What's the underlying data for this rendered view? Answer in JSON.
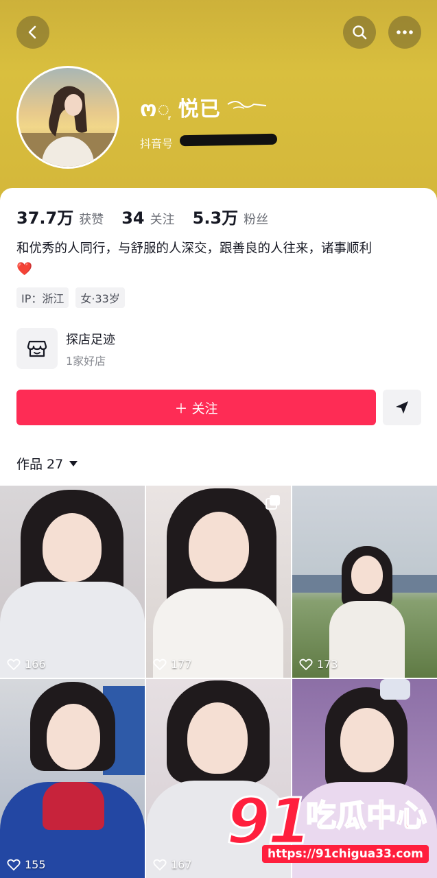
{
  "header": {
    "name": "ო◌᷊ 悦已",
    "douyin_id_label": "抖音号",
    "background_color": "#d9bf3e"
  },
  "icons": {
    "back": "back-icon",
    "search": "search-icon",
    "more": "more-icon",
    "shop": "shop-icon",
    "send": "send-icon",
    "dropdown": "caret-down-icon",
    "like": "heart-icon"
  },
  "stats": {
    "likes_num": "37.7万",
    "likes_label": "获赞",
    "following_num": "34",
    "following_label": "关注",
    "followers_num": "5.3万",
    "followers_label": "粉丝"
  },
  "bio": {
    "text": "和优秀的人同行，与舒服的人深交，跟善良的人往来，诸事顺利",
    "emoji": "❤️"
  },
  "tags": [
    "IP：浙江",
    "女·33岁"
  ],
  "shop": {
    "title": "探店足迹",
    "subtitle": "1家好店"
  },
  "actions": {
    "follow_label": "＋ 关注"
  },
  "works": {
    "label": "作品 27"
  },
  "tiles": [
    {
      "likes": "166"
    },
    {
      "likes": "177"
    },
    {
      "likes": "173"
    },
    {
      "likes": "155"
    },
    {
      "likes": "167"
    },
    {
      "likes": ""
    }
  ],
  "watermark": {
    "big": "91",
    "cn": "吃瓜中心",
    "url": "https://91chigua33.com"
  },
  "colors": {
    "accent": "#fe2c55",
    "watermark": "#ff1f3d"
  }
}
